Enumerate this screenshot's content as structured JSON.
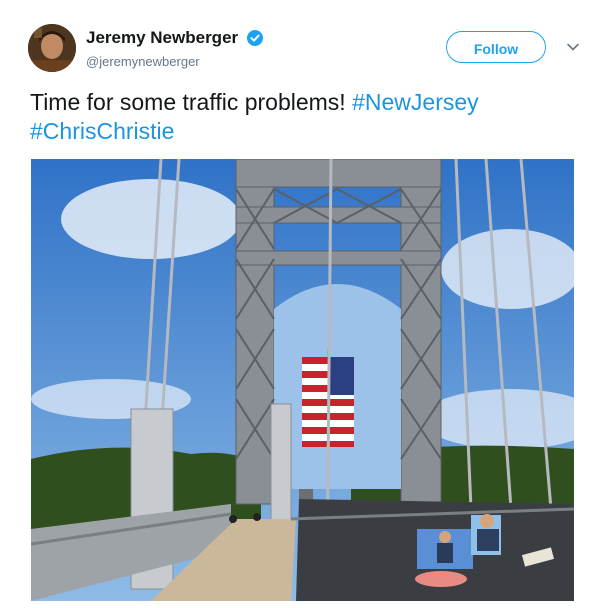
{
  "user": {
    "display_name": "Jeremy Newberger",
    "handle": "@jeremynewberger"
  },
  "follow_label": "Follow",
  "tweet": {
    "text": "Time for some traffic problems!",
    "hashtags": [
      "#NewJersey",
      "#ChrisChristie"
    ]
  },
  "colors": {
    "accent": "#1da1f2",
    "hashtag": "#1b95e0",
    "handle": "#657786"
  },
  "icons": [
    "verified-badge-icon",
    "chevron-down-icon"
  ]
}
